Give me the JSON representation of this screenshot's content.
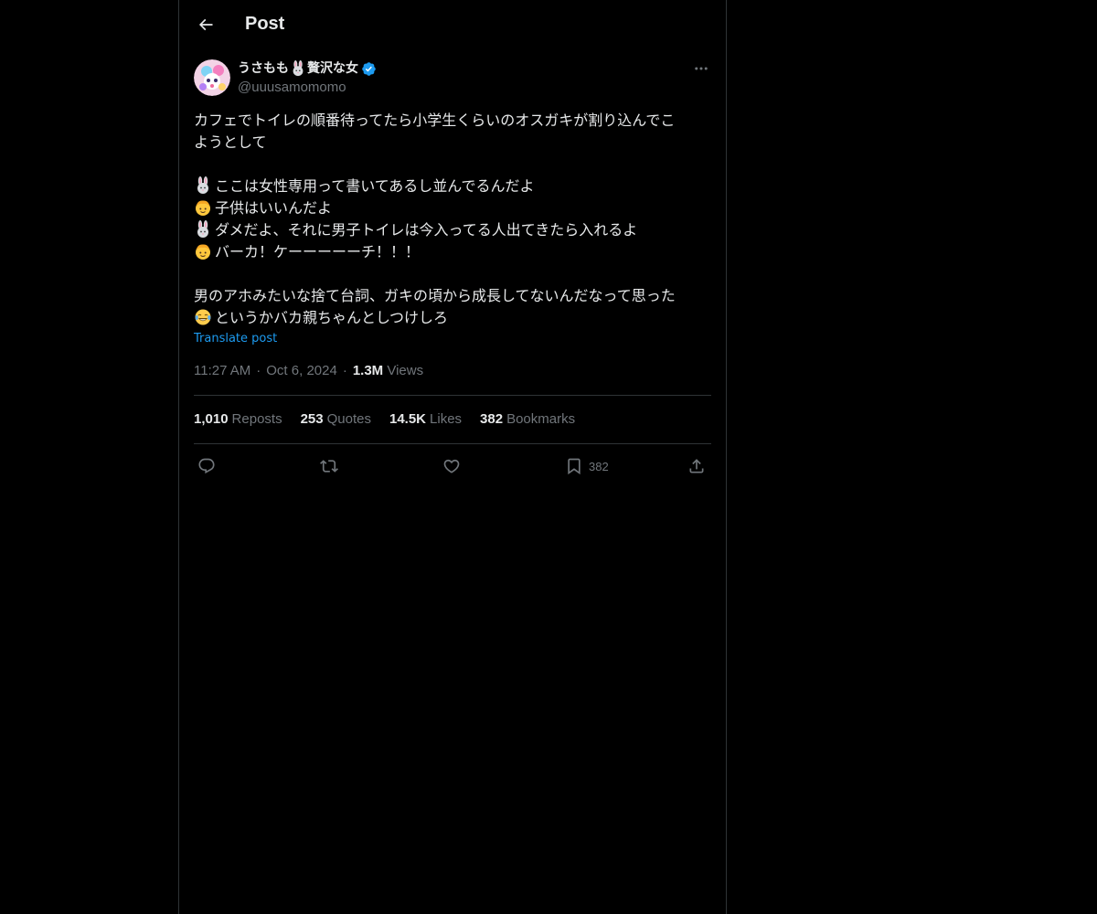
{
  "header": {
    "title": "Post"
  },
  "author": {
    "display_name_part1": "うさもも",
    "display_name_part2": "贅沢な女",
    "handle": "@uuusamomomo",
    "verified": true
  },
  "post": {
    "lines": [
      {
        "text": "カフェでトイレの順番待ってたら小学生くらいのオスガキが割り込んでこ"
      },
      {
        "text": "ようとして"
      },
      {
        "text": ""
      },
      {
        "emoji": "rabbit-icon",
        "text": "ここは女性専用って書いてあるし並んでるんだよ"
      },
      {
        "emoji": "boy-icon",
        "text": "子供はいいんだよ"
      },
      {
        "emoji": "rabbit-icon",
        "text": "ダメだよ、それに男子トイレは今入ってる人出てきたら入れるよ"
      },
      {
        "emoji": "boy-icon",
        "text": "バーカ！ケーーーーーチ！！！"
      },
      {
        "text": ""
      },
      {
        "text": "男のアホみたいな捨て台詞、ガキの頃から成長してないんだなって思った"
      },
      {
        "emoji": "tears-of-joy-icon",
        "text": "というかバカ親ちゃんとしつけしろ"
      }
    ],
    "translate_label": "Translate post",
    "time": "11:27 AM",
    "date": "Oct 6, 2024",
    "views_count": "1.3M",
    "views_label": "Views"
  },
  "stats": {
    "reposts": {
      "count": "1,010",
      "label": "Reposts"
    },
    "quotes": {
      "count": "253",
      "label": "Quotes"
    },
    "likes": {
      "count": "14.5K",
      "label": "Likes"
    },
    "bookmarks": {
      "count": "382",
      "label": "Bookmarks"
    }
  },
  "actions": {
    "bookmark_count": "382"
  },
  "colors": {
    "background": "#000000",
    "text": "#e7e9ea",
    "muted": "#71767b",
    "accent": "#1d9bf0",
    "border": "#2f3336"
  }
}
